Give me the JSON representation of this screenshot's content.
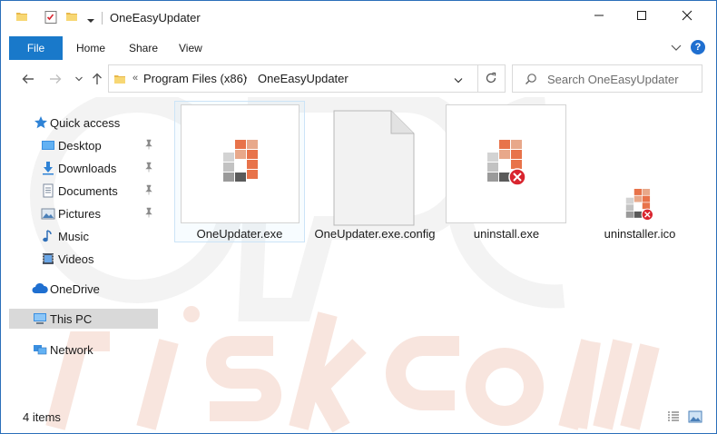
{
  "window": {
    "title": "OneEasyUpdater",
    "controls": {
      "minimize": "minimize",
      "maximize": "maximize",
      "close": "close"
    }
  },
  "ribbon": {
    "file_tab": "File",
    "tabs": [
      "Home",
      "Share",
      "View"
    ]
  },
  "address": {
    "breadcrumbs": [
      "Program Files (x86)",
      "OneEasyUpdater"
    ]
  },
  "search": {
    "placeholder": "Search OneEasyUpdater"
  },
  "navpane": {
    "items": [
      {
        "label": "Quick access",
        "icon": "star-icon"
      },
      {
        "label": "Desktop",
        "icon": "desktop-icon",
        "pinned": true
      },
      {
        "label": "Downloads",
        "icon": "download-icon",
        "pinned": true
      },
      {
        "label": "Documents",
        "icon": "documents-icon",
        "pinned": true
      },
      {
        "label": "Pictures",
        "icon": "pictures-icon",
        "pinned": true
      },
      {
        "label": "Music",
        "icon": "music-icon"
      },
      {
        "label": "Videos",
        "icon": "videos-icon"
      },
      {
        "label": "OneDrive",
        "icon": "cloud-icon"
      },
      {
        "label": "This PC",
        "icon": "computer-icon",
        "selected": true
      },
      {
        "label": "Network",
        "icon": "network-icon"
      }
    ]
  },
  "files": [
    {
      "name": "OneUpdater.exe",
      "icon": "app-icon",
      "selected": true
    },
    {
      "name": "OneUpdater.exe.config",
      "icon": "blank-file-icon"
    },
    {
      "name": "uninstall.exe",
      "icon": "uninstall-app-icon"
    },
    {
      "name": "uninstaller.ico",
      "icon": "uninstall-app-icon-small"
    }
  ],
  "status": {
    "item_count": "4 items"
  },
  "colors": {
    "accent": "#1979ca",
    "orange": "#e8734a",
    "grey_dark": "#5a5a5a",
    "grey_mid": "#9a9a9a",
    "grey_light": "#cfcfcf",
    "error_red": "#d9252f",
    "selection": "#d9d9d9"
  }
}
